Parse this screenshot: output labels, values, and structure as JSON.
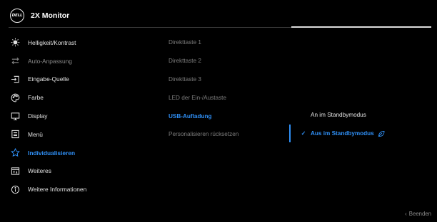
{
  "header": {
    "logo_text": "DELL",
    "title": "2X Monitor"
  },
  "menu": {
    "items": [
      {
        "label": "Helligkeit/Kontrast",
        "icon": "brightness-icon",
        "state": "normal"
      },
      {
        "label": "Auto-Anpassung",
        "icon": "auto-adjust-icon",
        "state": "disabled"
      },
      {
        "label": "Eingabe-Quelle",
        "icon": "input-source-icon",
        "state": "normal"
      },
      {
        "label": "Farbe",
        "icon": "palette-icon",
        "state": "normal"
      },
      {
        "label": "Display",
        "icon": "display-icon",
        "state": "normal"
      },
      {
        "label": "Menü",
        "icon": "menu-icon",
        "state": "normal"
      },
      {
        "label": "Individualisieren",
        "icon": "star-icon",
        "state": "active"
      },
      {
        "label": "Weiteres",
        "icon": "others-icon",
        "state": "normal"
      },
      {
        "label": "Weitere Informationen",
        "icon": "info-icon",
        "state": "normal"
      }
    ]
  },
  "submenu": {
    "items": [
      {
        "label": "Direkttaste 1",
        "state": "normal"
      },
      {
        "label": "Direkttaste 2",
        "state": "normal"
      },
      {
        "label": "Direkttaste 3",
        "state": "normal"
      },
      {
        "label": "LED der Ein-/Austaste",
        "state": "normal"
      },
      {
        "label": "USB-Aufladung",
        "state": "active"
      },
      {
        "label": "Personalisieren rücksetzen",
        "state": "normal"
      }
    ]
  },
  "options": {
    "items": [
      {
        "label": "An im Standbymodus",
        "selected": false
      },
      {
        "label": "Aus im Standbymodus",
        "selected": true
      }
    ]
  },
  "footer": {
    "exit_label": "Beenden",
    "exit_glyph": "‹"
  },
  "colors": {
    "accent": "#2f8ff5",
    "background": "#000000",
    "text": "#e0e0e0",
    "muted": "#7d7d7d"
  }
}
